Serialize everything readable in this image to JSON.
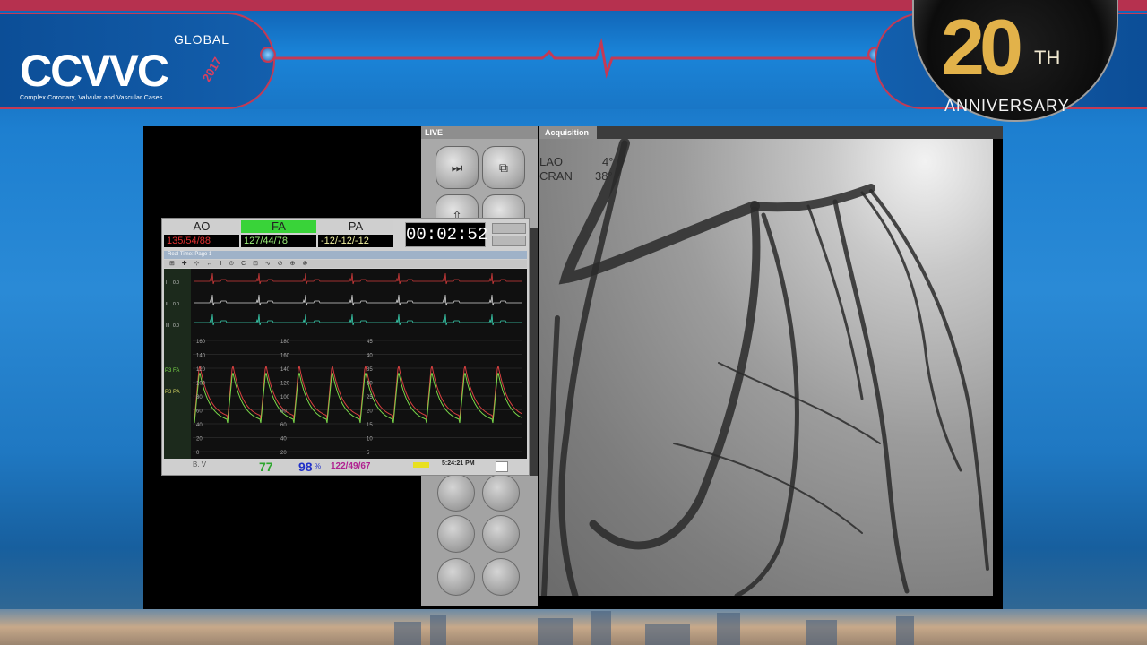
{
  "banner": {
    "logo_text": "CCVVC",
    "logo_global": "GLOBAL",
    "logo_year": "2017",
    "logo_subtitle": "Complex Coronary, Valvular and Vascular Cases",
    "anniv_number": "20",
    "anniv_suffix": "TH",
    "anniv_word": "ANNIVERSARY"
  },
  "control_panel": {
    "live_label": "LIVE"
  },
  "angio": {
    "tab_label": "Acquisition",
    "lao_label": "LAO",
    "lao_value": "4°",
    "cran_label": "CRAN",
    "cran_value": "38°",
    "vessel_color": "#2a2a2a"
  },
  "monitor": {
    "channels": [
      {
        "label": "AO",
        "value": "135/54/88",
        "value_color": "#e23030",
        "label_bg": "#cfcfcf"
      },
      {
        "label": "FA",
        "value": "127/44/78",
        "value_color": "#9cf07a",
        "label_bg": "#39d339"
      },
      {
        "label": "PA",
        "value": "-12/-12/-12",
        "value_color": "#f0f0a0",
        "label_bg": "#cfcfcf"
      }
    ],
    "timer": "00:02:52",
    "title": "Real Time: Page 1",
    "tools": "⊞ ✚ ⊹ ↔ I ⊙ C ⊡ ∿ ⊘ ⊕ ⊗",
    "lead_labels": [
      "I",
      "II",
      "III"
    ],
    "lead_values": [
      "0.0",
      "0.0",
      "0.0"
    ],
    "scale_left": [
      "160",
      "140",
      "120",
      "100",
      "80",
      "60",
      "40",
      "20",
      "0"
    ],
    "scale_mid": [
      "180",
      "160",
      "140",
      "120",
      "100",
      "80",
      "60",
      "40",
      "20"
    ],
    "scale_right": [
      "45",
      "40",
      "35",
      "30",
      "25",
      "20",
      "15",
      "10",
      "5"
    ],
    "trace_labels": [
      "P3 FA",
      "P3 PA"
    ],
    "trace_colors": {
      "ecg1": "#d03a3a",
      "ecg2": "#d0d0d0",
      "ecg3": "#3ad0b0",
      "art": "#d84040",
      "fa": "#7ad84a"
    },
    "bottom": {
      "bv_label": "B. V",
      "hr": "77",
      "spo2": "98",
      "spo2_unit": "%",
      "nibp": "122/49/67",
      "clock": "5:24:21 PM"
    }
  }
}
